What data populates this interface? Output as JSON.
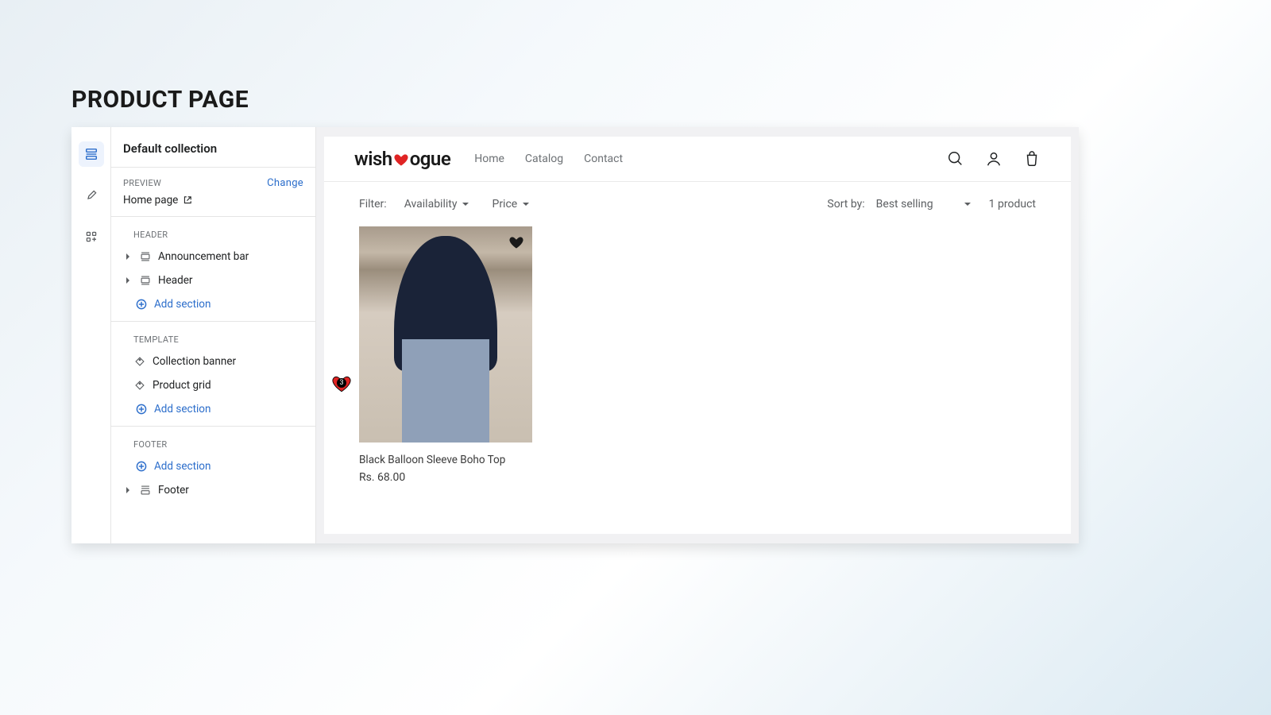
{
  "page_title": "PRODUCT PAGE",
  "sidebar": {
    "title": "Default collection",
    "preview_label": "PREVIEW",
    "change_label": "Change",
    "preview_page": "Home page",
    "groups": {
      "header": {
        "label": "HEADER",
        "items": [
          "Announcement bar",
          "Header"
        ],
        "add": "Add section"
      },
      "template": {
        "label": "TEMPLATE",
        "items": [
          "Collection banner",
          "Product grid"
        ],
        "add": "Add section"
      },
      "footer": {
        "label": "FOOTER",
        "add": "Add section",
        "items": [
          "Footer"
        ]
      }
    }
  },
  "store": {
    "brand_pre": "wish",
    "brand_post": "ogue",
    "nav": [
      "Home",
      "Catalog",
      "Contact"
    ],
    "filter_label": "Filter:",
    "filter_availability": "Availability",
    "filter_price": "Price",
    "sort_label": "Sort by:",
    "sort_value": "Best selling",
    "product_count": "1 product",
    "product": {
      "title": "Black Balloon Sleeve Boho Top",
      "price": "Rs. 68.00"
    },
    "wishlist_count": "3"
  }
}
